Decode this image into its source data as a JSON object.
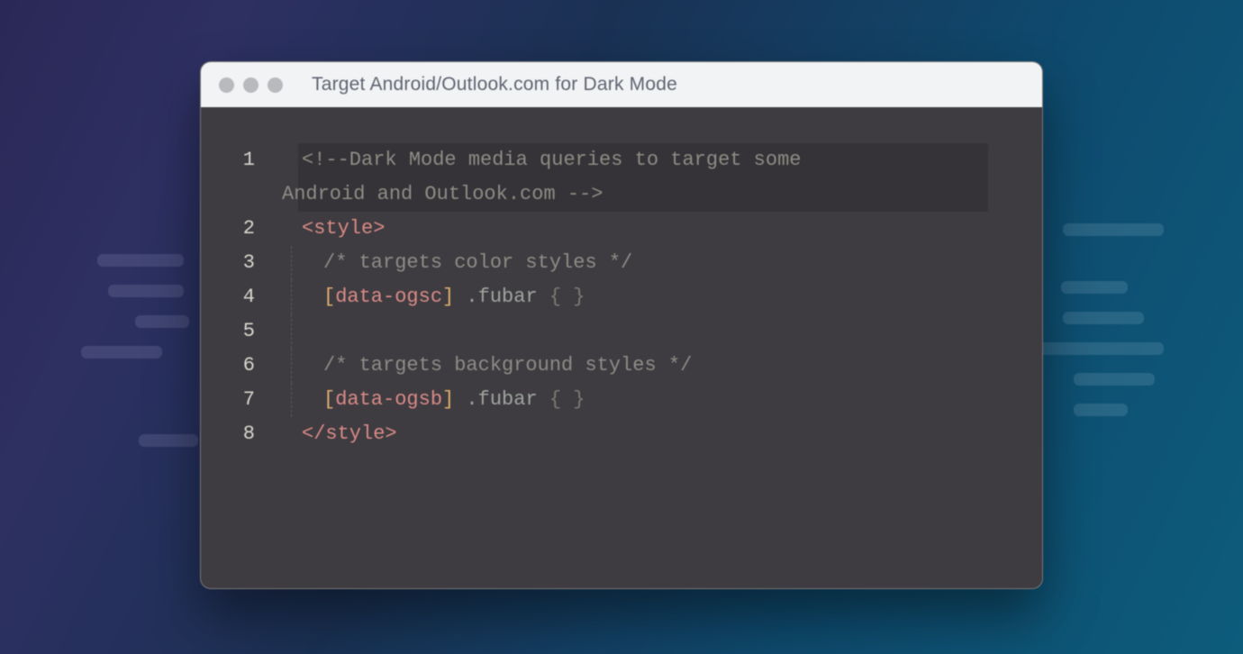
{
  "window": {
    "title": "Target Android/Outlook.com for Dark Mode"
  },
  "code": {
    "line_numbers": [
      "1",
      "2",
      "3",
      "4",
      "5",
      "6",
      "7",
      "8"
    ],
    "l1a": "<!--Dark Mode media queries to target some",
    "l1b": "Android and Outlook.com -->",
    "l2_open": "<",
    "l2_tag": "style",
    "l2_close": ">",
    "l3": "/* targets color styles */",
    "l4_lb": "[",
    "l4_attr": "data-ogsc",
    "l4_rb": "]",
    "l4_sel": " .fubar ",
    "l4_cbo": "{ ",
    "l4_cbc": "}",
    "l6": "/* targets background styles */",
    "l7_lb": "[",
    "l7_attr": "data-ogsb",
    "l7_rb": "]",
    "l7_sel": " .fubar ",
    "l7_cbo": "{ ",
    "l7_cbc": "}",
    "l8_open": "</",
    "l8_tag": "style",
    "l8_close": ">"
  }
}
